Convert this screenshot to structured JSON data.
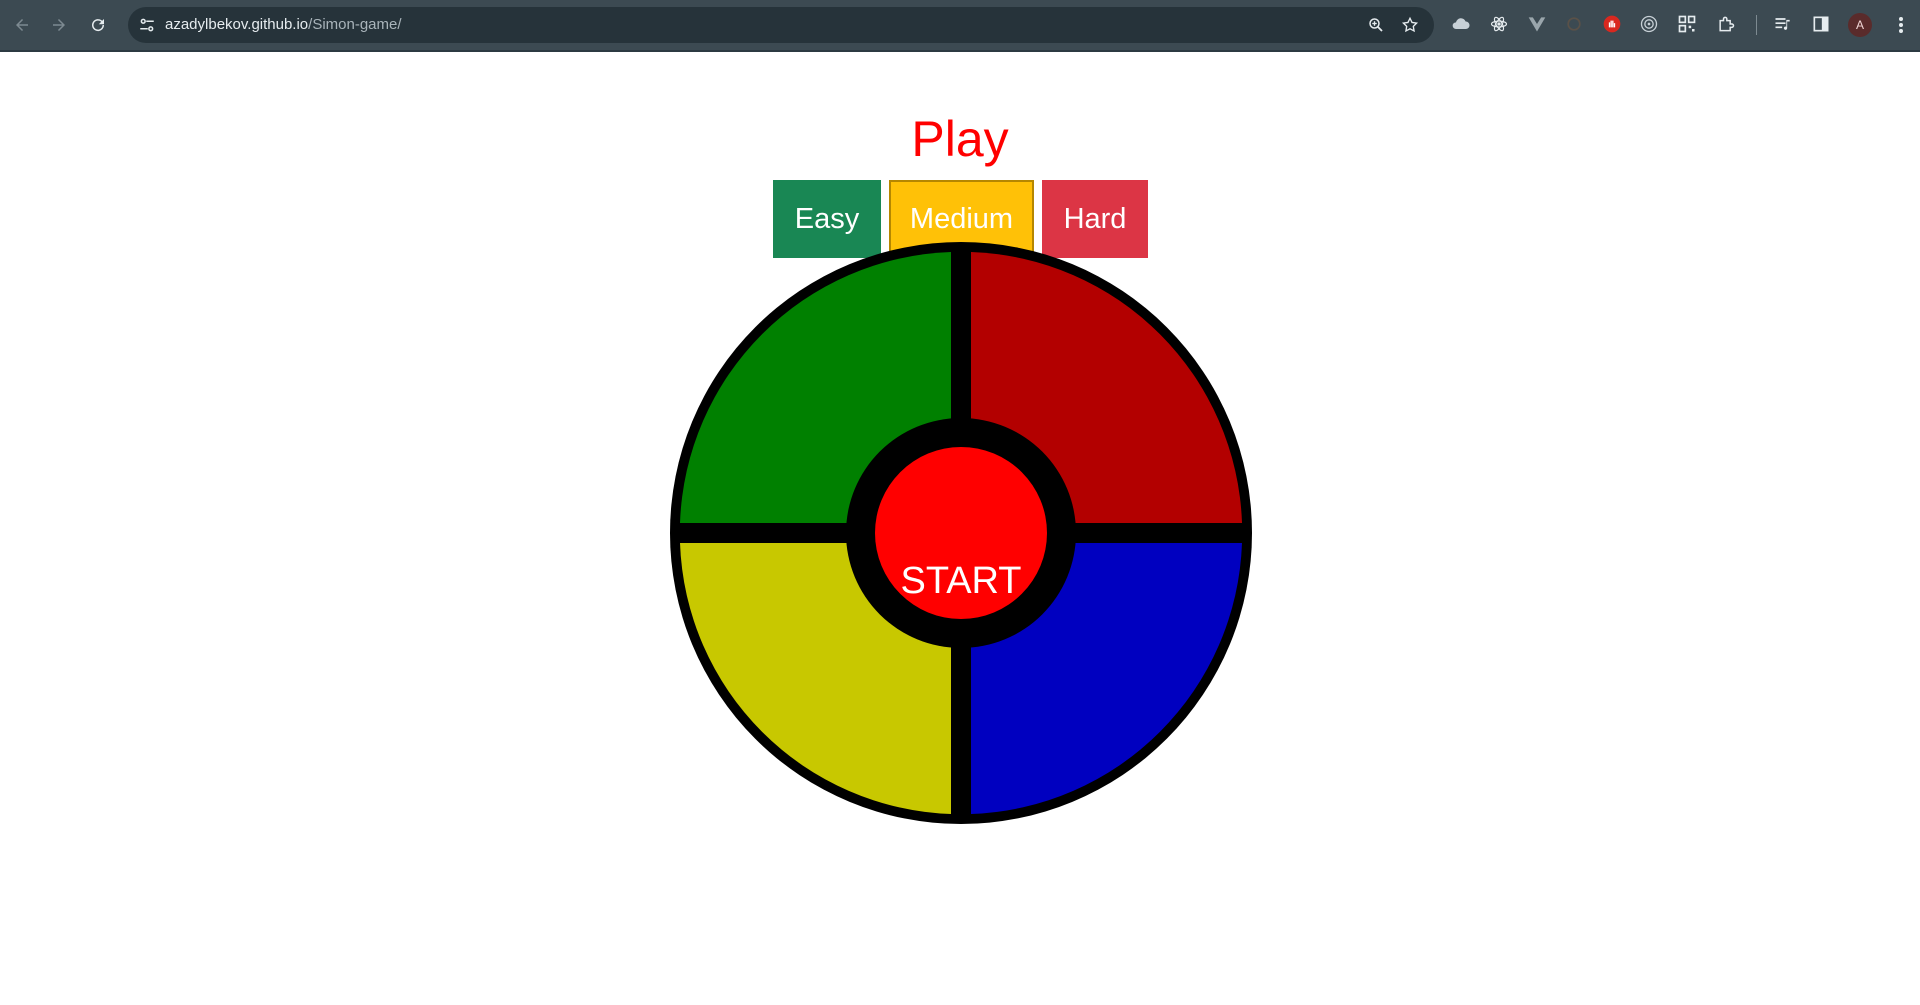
{
  "browser": {
    "url_domain": "azadylbekov.github.io",
    "url_path": "/Simon-game/",
    "profile_initial": "A"
  },
  "game": {
    "title": "Play",
    "levels": [
      {
        "label": "Easy",
        "color": "#198754"
      },
      {
        "label": "Medium",
        "color": "#ffc107"
      },
      {
        "label": "Hard",
        "color": "#dc3545"
      }
    ],
    "pads": {
      "top_left": "#008000",
      "top_right": "#b30000",
      "bottom_left": "#c8c800",
      "bottom_right": "#0000c0"
    },
    "start_label": "START",
    "start_color": "#ff0000"
  }
}
